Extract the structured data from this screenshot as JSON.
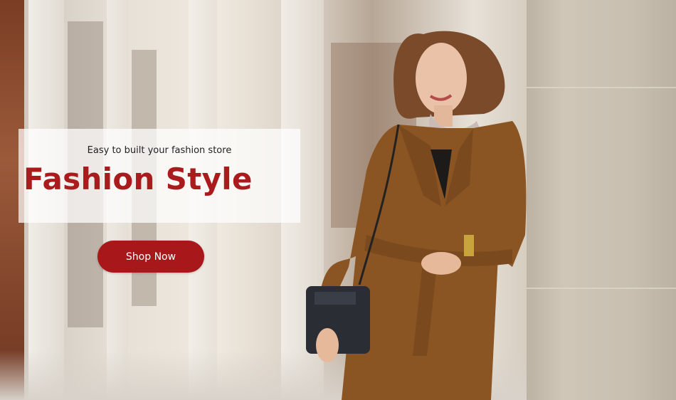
{
  "banner": {
    "tagline": "Easy to built your fashion store",
    "headline": "Fashion Style",
    "cta_label": "Shop Now"
  },
  "colors": {
    "accent": "#a91b1d",
    "button": "#a8181b",
    "coat": "#8a5523"
  }
}
